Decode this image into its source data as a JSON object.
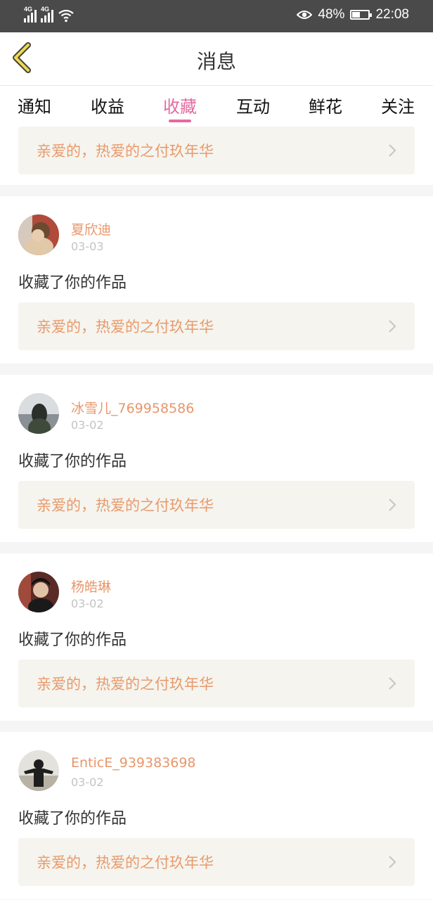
{
  "status_bar": {
    "network_1": "4G",
    "network_2": "4G",
    "battery_percent": "48%",
    "battery_level": 0.48,
    "time": "22:08"
  },
  "header": {
    "title": "消息",
    "back_icon": "chevron-left-icon"
  },
  "tabs": [
    {
      "label": "通知",
      "active": false
    },
    {
      "label": "收益",
      "active": false
    },
    {
      "label": "收藏",
      "active": true
    },
    {
      "label": "互动",
      "active": false
    },
    {
      "label": "鲜花",
      "active": false
    },
    {
      "label": "关注",
      "active": false
    }
  ],
  "colors": {
    "accent": "#e36aa0",
    "username": "#e8966b",
    "work_title": "#e89a6c",
    "work_bg": "#f5f4ee"
  },
  "feed": {
    "partial_item": {
      "work_title": "亲爱的，热爱的之付玖年华"
    },
    "items": [
      {
        "username": "夏欣迪",
        "date": "03-03",
        "action": "收藏了你的作品",
        "work_title": "亲爱的，热爱的之付玖年华"
      },
      {
        "username": "冰雪儿_769958586",
        "date": "03-02",
        "action": "收藏了你的作品",
        "work_title": "亲爱的，热爱的之付玖年华"
      },
      {
        "username": "杨皓琳",
        "date": "03-02",
        "action": "收藏了你的作品",
        "work_title": "亲爱的，热爱的之付玖年华"
      },
      {
        "username": "EnticE_939383698",
        "date": "03-02",
        "action": "收藏了你的作品",
        "work_title": "亲爱的，热爱的之付玖年华"
      }
    ]
  }
}
